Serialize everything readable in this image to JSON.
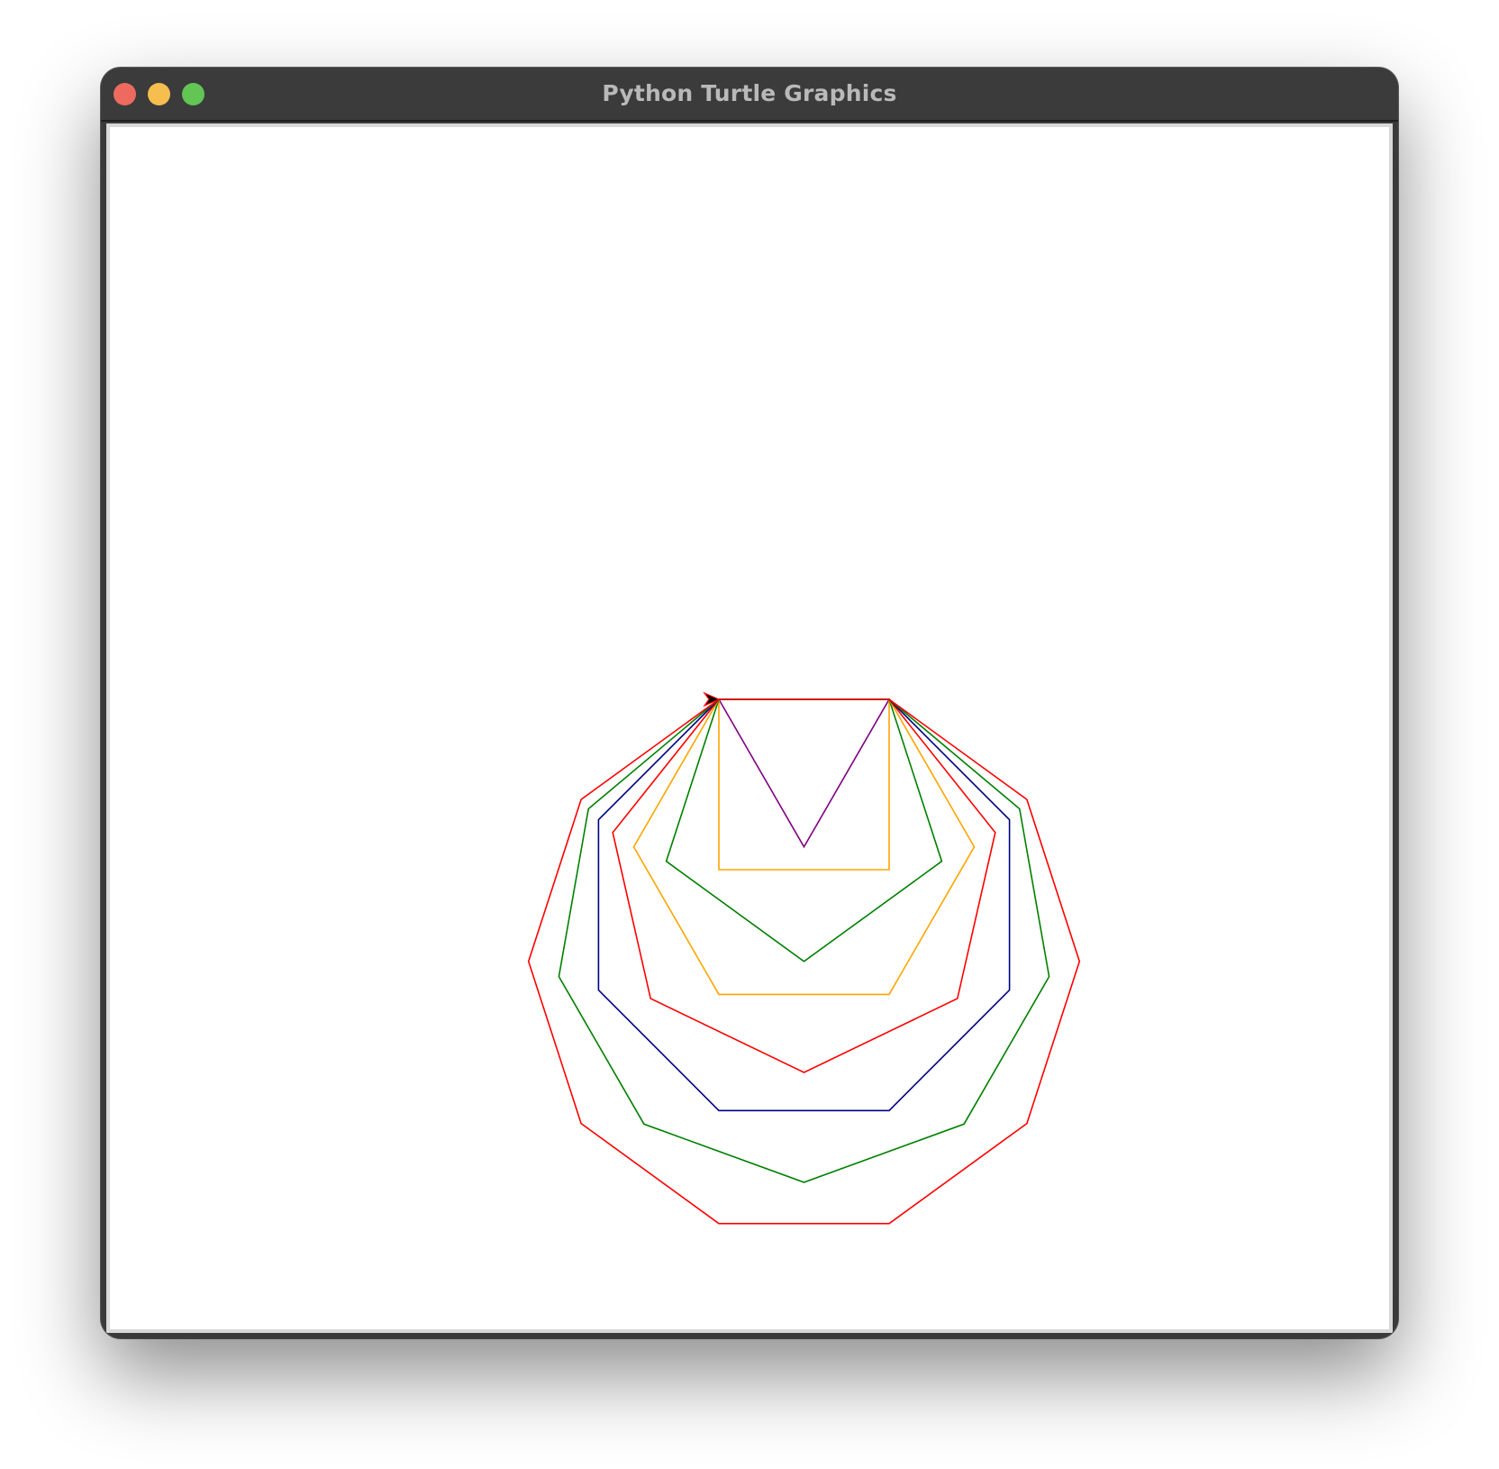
{
  "window": {
    "title": "Python Turtle Graphics"
  },
  "traffic_lights": {
    "close_color": "#ee6a5f",
    "minimize_color": "#f5be4f",
    "zoom_color": "#62c554"
  },
  "canvas": {
    "background": "#ffffff"
  },
  "turtle": {
    "shape": "classic",
    "color": "#000000",
    "pen_color": "#ff0000"
  },
  "polygons": [
    {
      "sides": 3,
      "color": "#800080"
    },
    {
      "sides": 4,
      "color": "#ffa500"
    },
    {
      "sides": 5,
      "color": "#008000"
    },
    {
      "sides": 6,
      "color": "#ffa500"
    },
    {
      "sides": 7,
      "color": "#ff0000"
    },
    {
      "sides": 8,
      "color": "#000080"
    },
    {
      "sides": 9,
      "color": "#008000"
    },
    {
      "sides": 10,
      "color": "#ff0000"
    }
  ]
}
